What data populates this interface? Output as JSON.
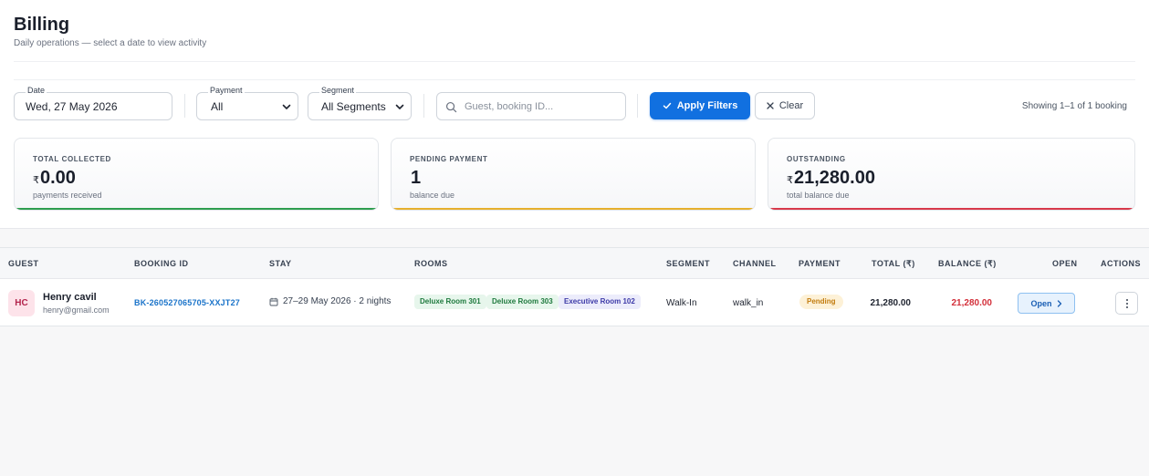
{
  "page": {
    "title": "Billing",
    "subtitle": "Daily operations — select a date to view activity"
  },
  "filters": {
    "date_label": "Date",
    "date_value": "Wed, 27 May 2026",
    "payment_label": "Payment",
    "payment_value": "All",
    "segment_label": "Segment",
    "segment_value": "All Segments",
    "search_placeholder": "Guest, booking ID...",
    "apply_label": "Apply Filters",
    "clear_label": "Clear",
    "showing_text": "Showing 1–1 of 1 booking"
  },
  "summary": [
    {
      "label": "TOTAL COLLECTED",
      "currency": "₹",
      "value": "0.00",
      "sub": "payments received",
      "color": "#2e9e4f"
    },
    {
      "label": "PENDING PAYMENT",
      "currency": "",
      "value": "1",
      "sub": "balance due",
      "color": "#e6b02e"
    },
    {
      "label": "OUTSTANDING",
      "currency": "₹",
      "value": "21,280.00",
      "sub": "total balance due",
      "color": "#d8394a"
    }
  ],
  "table": {
    "headers": [
      "GUEST",
      "BOOKING ID",
      "STAY",
      "ROOMS",
      "SEGMENT",
      "CHANNEL",
      "PAYMENT",
      "TOTAL (₹)",
      "BALANCE (₹)",
      "OPEN",
      "ACTIONS"
    ],
    "rows": [
      {
        "initials": "HC",
        "name": "Henry cavil",
        "email": "henry@gmail.com",
        "booking_id": "BK-260527065705-XXJT27",
        "stay": "27–29 May 2026 · 2 nights",
        "rooms": [
          "Deluxe Room 301",
          "Deluxe Room 303",
          "Executive Room 102"
        ],
        "segment": "Walk-In",
        "channel": "walk_in",
        "payment": "Pending",
        "total": "21,280.00",
        "balance": "21,280.00",
        "open_label": "Open"
      }
    ]
  },
  "colors": {
    "accent": "#1170e0",
    "balance": "#d32f3a",
    "pending": "#c27c0e"
  },
  "icons": {
    "select": "chevron-down-icon",
    "search": "search-icon",
    "apply": "check-icon",
    "clear": "close-icon",
    "stay": "calendar-icon",
    "open": "chevron-right-icon",
    "actions": "more-vertical-icon"
  }
}
